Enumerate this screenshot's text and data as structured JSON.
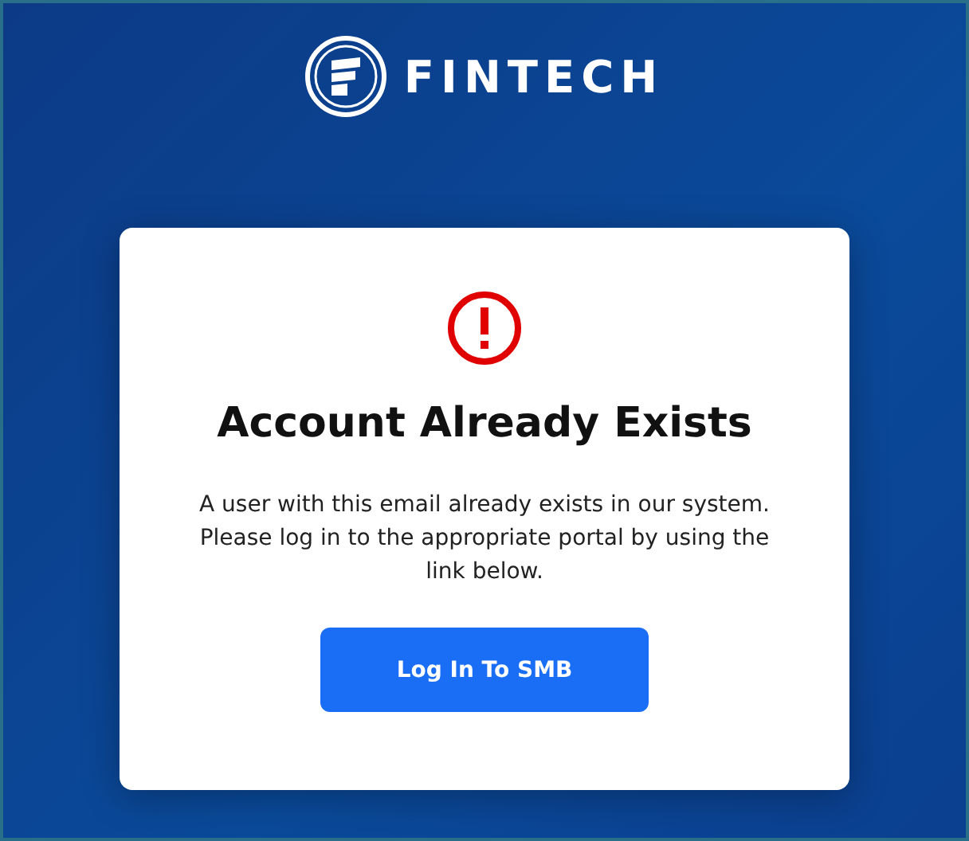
{
  "brand": {
    "name": "FINTECH"
  },
  "dialog": {
    "title": "Account Already Exists",
    "message": "A user with this email already exists in our system. Please log in to the appropriate portal by using the link below.",
    "button": "Log In To SMB"
  }
}
